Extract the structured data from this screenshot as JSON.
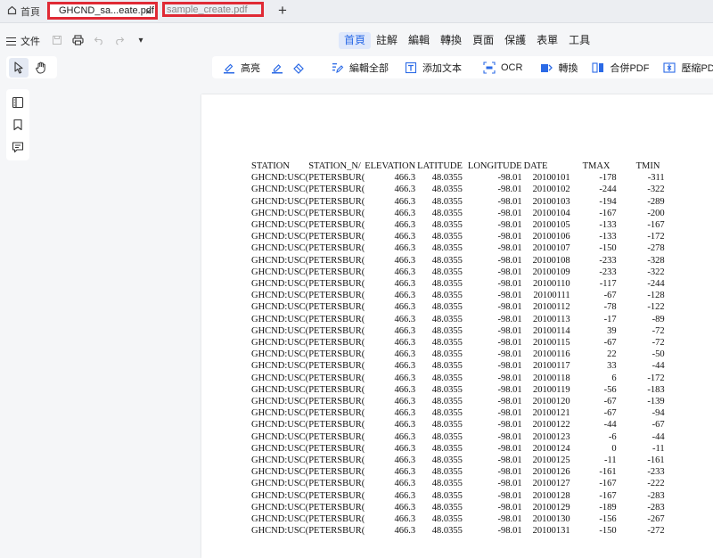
{
  "tabs": {
    "home_label": "首頁",
    "active_label": "GHCND_sa...eate.pdf",
    "inactive_label": "sample_create.pdf",
    "add_label": "+",
    "close_label": "×"
  },
  "toolbar": {
    "file_label": "文件",
    "more_label": "▾",
    "nav": [
      "首頁",
      "註解",
      "編輯",
      "轉換",
      "頁面",
      "保護",
      "表單",
      "工具"
    ],
    "active_nav": 0
  },
  "actions": {
    "highlight": "高亮",
    "edit_all": "編輯全部",
    "add_text": "添加文本",
    "ocr": "OCR",
    "convert": "轉換",
    "merge": "合併PDF",
    "compress": "壓縮PDF"
  },
  "icons": {
    "home": "home-icon",
    "save": "save-icon",
    "print": "print-icon",
    "undo": "undo-icon",
    "redo": "redo-icon",
    "select": "cursor-icon",
    "hand": "hand-icon",
    "thumbnails": "thumbnails-icon",
    "bookmark": "bookmark-icon",
    "comment": "comment-icon"
  },
  "colors": {
    "accent": "#2b6ae6",
    "highlight_border": "#e02a35"
  },
  "document": {
    "headers": [
      "STATION",
      "STATION_N/",
      "ELEVATION",
      "LATITUDE",
      "LONGITUDE",
      "DATE",
      "TMAX",
      "TMIN"
    ],
    "rows": [
      [
        "GHCND:USC(",
        "PETERSBUR(",
        "466.3",
        "48.0355",
        "-98.01",
        "20100101",
        "-178",
        "-311"
      ],
      [
        "GHCND:USC(",
        "PETERSBUR(",
        "466.3",
        "48.0355",
        "-98.01",
        "20100102",
        "-244",
        "-322"
      ],
      [
        "GHCND:USC(",
        "PETERSBUR(",
        "466.3",
        "48.0355",
        "-98.01",
        "20100103",
        "-194",
        "-289"
      ],
      [
        "GHCND:USC(",
        "PETERSBUR(",
        "466.3",
        "48.0355",
        "-98.01",
        "20100104",
        "-167",
        "-200"
      ],
      [
        "GHCND:USC(",
        "PETERSBUR(",
        "466.3",
        "48.0355",
        "-98.01",
        "20100105",
        "-133",
        "-167"
      ],
      [
        "GHCND:USC(",
        "PETERSBUR(",
        "466.3",
        "48.0355",
        "-98.01",
        "20100106",
        "-133",
        "-172"
      ],
      [
        "GHCND:USC(",
        "PETERSBUR(",
        "466.3",
        "48.0355",
        "-98.01",
        "20100107",
        "-150",
        "-278"
      ],
      [
        "GHCND:USC(",
        "PETERSBUR(",
        "466.3",
        "48.0355",
        "-98.01",
        "20100108",
        "-233",
        "-328"
      ],
      [
        "GHCND:USC(",
        "PETERSBUR(",
        "466.3",
        "48.0355",
        "-98.01",
        "20100109",
        "-233",
        "-322"
      ],
      [
        "GHCND:USC(",
        "PETERSBUR(",
        "466.3",
        "48.0355",
        "-98.01",
        "20100110",
        "-117",
        "-244"
      ],
      [
        "GHCND:USC(",
        "PETERSBUR(",
        "466.3",
        "48.0355",
        "-98.01",
        "20100111",
        "-67",
        "-128"
      ],
      [
        "GHCND:USC(",
        "PETERSBUR(",
        "466.3",
        "48.0355",
        "-98.01",
        "20100112",
        "-78",
        "-122"
      ],
      [
        "GHCND:USC(",
        "PETERSBUR(",
        "466.3",
        "48.0355",
        "-98.01",
        "20100113",
        "-17",
        "-89"
      ],
      [
        "GHCND:USC(",
        "PETERSBUR(",
        "466.3",
        "48.0355",
        "-98.01",
        "20100114",
        "39",
        "-72"
      ],
      [
        "GHCND:USC(",
        "PETERSBUR(",
        "466.3",
        "48.0355",
        "-98.01",
        "20100115",
        "-67",
        "-72"
      ],
      [
        "GHCND:USC(",
        "PETERSBUR(",
        "466.3",
        "48.0355",
        "-98.01",
        "20100116",
        "22",
        "-50"
      ],
      [
        "GHCND:USC(",
        "PETERSBUR(",
        "466.3",
        "48.0355",
        "-98.01",
        "20100117",
        "33",
        "-44"
      ],
      [
        "GHCND:USC(",
        "PETERSBUR(",
        "466.3",
        "48.0355",
        "-98.01",
        "20100118",
        "6",
        "-172"
      ],
      [
        "GHCND:USC(",
        "PETERSBUR(",
        "466.3",
        "48.0355",
        "-98.01",
        "20100119",
        "-56",
        "-183"
      ],
      [
        "GHCND:USC(",
        "PETERSBUR(",
        "466.3",
        "48.0355",
        "-98.01",
        "20100120",
        "-67",
        "-139"
      ],
      [
        "GHCND:USC(",
        "PETERSBUR(",
        "466.3",
        "48.0355",
        "-98.01",
        "20100121",
        "-67",
        "-94"
      ],
      [
        "GHCND:USC(",
        "PETERSBUR(",
        "466.3",
        "48.0355",
        "-98.01",
        "20100122",
        "-44",
        "-67"
      ],
      [
        "GHCND:USC(",
        "PETERSBUR(",
        "466.3",
        "48.0355",
        "-98.01",
        "20100123",
        "-6",
        "-44"
      ],
      [
        "GHCND:USC(",
        "PETERSBUR(",
        "466.3",
        "48.0355",
        "-98.01",
        "20100124",
        "0",
        "-11"
      ],
      [
        "GHCND:USC(",
        "PETERSBUR(",
        "466.3",
        "48.0355",
        "-98.01",
        "20100125",
        "-11",
        "-161"
      ],
      [
        "GHCND:USC(",
        "PETERSBUR(",
        "466.3",
        "48.0355",
        "-98.01",
        "20100126",
        "-161",
        "-233"
      ],
      [
        "GHCND:USC(",
        "PETERSBUR(",
        "466.3",
        "48.0355",
        "-98.01",
        "20100127",
        "-167",
        "-222"
      ],
      [
        "GHCND:USC(",
        "PETERSBUR(",
        "466.3",
        "48.0355",
        "-98.01",
        "20100128",
        "-167",
        "-283"
      ],
      [
        "GHCND:USC(",
        "PETERSBUR(",
        "466.3",
        "48.0355",
        "-98.01",
        "20100129",
        "-189",
        "-283"
      ],
      [
        "GHCND:USC(",
        "PETERSBUR(",
        "466.3",
        "48.0355",
        "-98.01",
        "20100130",
        "-156",
        "-267"
      ],
      [
        "GHCND:USC(",
        "PETERSBUR(",
        "466.3",
        "48.0355",
        "-98.01",
        "20100131",
        "-150",
        "-272"
      ]
    ]
  }
}
